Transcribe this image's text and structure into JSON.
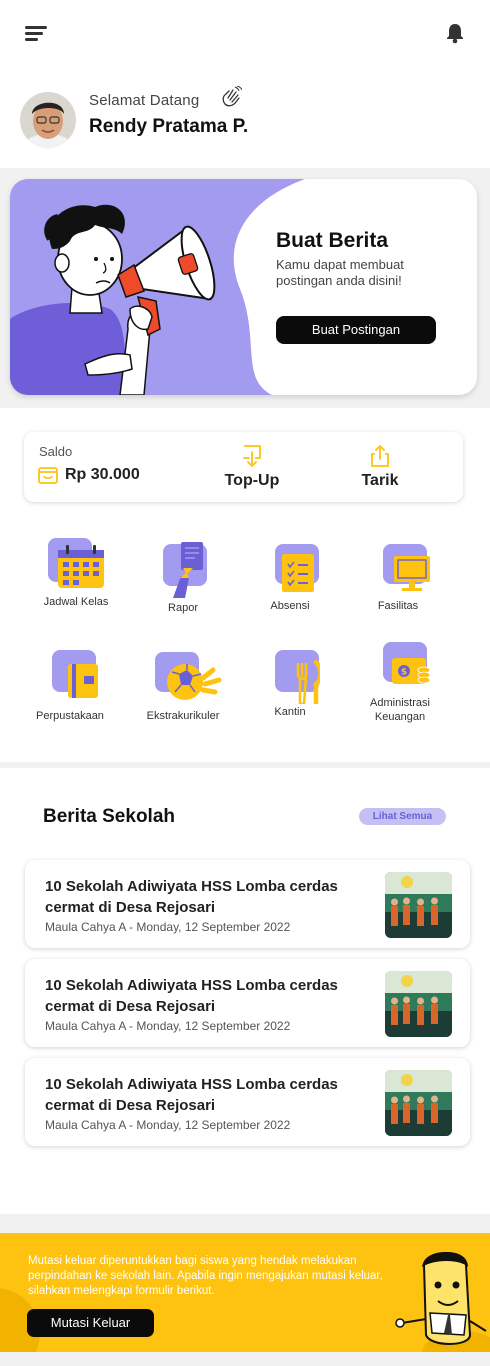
{
  "header": {
    "greeting": "Selamat Datang",
    "user_name": "Rendy Pratama P."
  },
  "banner": {
    "title": "Buat Berita",
    "description": "Kamu dapat membuat postingan anda disini!",
    "button_label": "Buat Postingan"
  },
  "wallet": {
    "label": "Saldo",
    "amount": "Rp 30.000",
    "topup_label": "Top-Up",
    "withdraw_label": "Tarik"
  },
  "menu": [
    {
      "label": "Jadwal Kelas",
      "icon": "calendar-icon"
    },
    {
      "label": "Rapor",
      "icon": "report-book-icon"
    },
    {
      "label": "Absensi",
      "icon": "checklist-icon"
    },
    {
      "label": "Fasilitas",
      "icon": "monitor-icon"
    },
    {
      "label": "Perpustakaan",
      "icon": "library-book-icon"
    },
    {
      "label": "Ekstrakurikuler",
      "icon": "ball-icon"
    },
    {
      "label": "Kantin",
      "icon": "fork-knife-icon"
    },
    {
      "label": "Administrasi Keuangan",
      "icon": "money-icon"
    }
  ],
  "news": {
    "title": "Berita Sekolah",
    "see_all_label": "Lihat Semua",
    "items": [
      {
        "headline": "10 Sekolah Adiwiyata HSS Lomba cerdas cermat di Desa Rejosari",
        "meta": "Maula Cahya A - Monday, 12 September 2022"
      },
      {
        "headline": "10 Sekolah Adiwiyata HSS Lomba cerdas cermat di Desa Rejosari",
        "meta": "Maula Cahya A - Monday, 12 September 2022"
      },
      {
        "headline": "10 Sekolah Adiwiyata HSS Lomba cerdas cermat di Desa Rejosari",
        "meta": "Maula Cahya A - Monday, 12 September 2022"
      }
    ]
  },
  "footer": {
    "text": "Mutasi keluar diperuntukkan bagi siswa yang hendak melakukan perpindahan ke sekolah lain. Apabila ingin mengajukan mutasi keluar, silahkan melengkapi formulir berikut.",
    "button_label": "Mutasi Keluar"
  },
  "colors": {
    "accent_purple": "#a29bf0",
    "accent_yellow": "#fdc310",
    "dark": "#0b0b0b"
  }
}
